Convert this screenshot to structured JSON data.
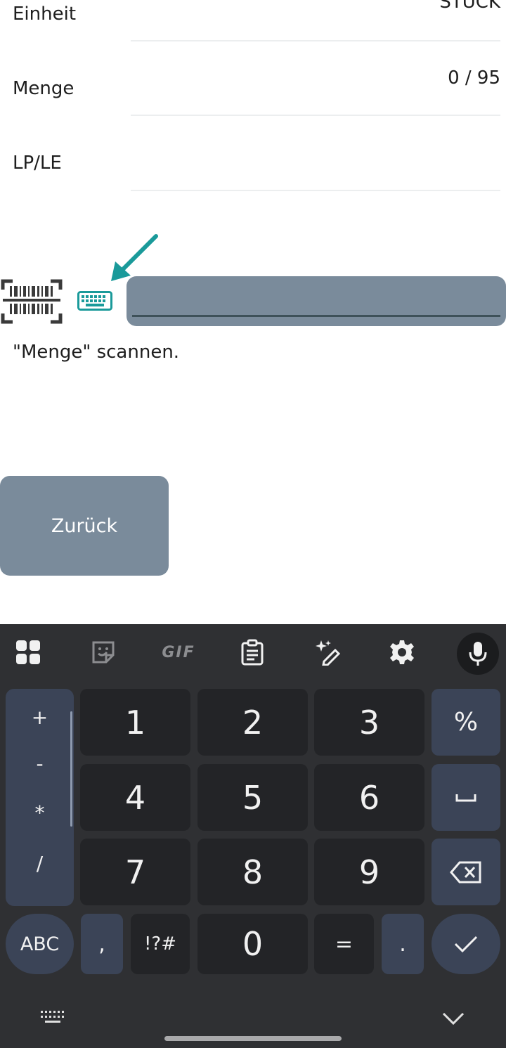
{
  "form": {
    "rows": [
      {
        "label": "Einheit",
        "value": "STÜCK"
      },
      {
        "label": "Menge",
        "value": "0 / 95"
      },
      {
        "label": "LP/LE",
        "value": ""
      }
    ]
  },
  "scan": {
    "input_value": "",
    "hint": "\"Menge\" scannen."
  },
  "buttons": {
    "back_label": "Zurück"
  },
  "colors": {
    "accent": "#7a8b9b",
    "annotation_arrow": "#1a9a9a",
    "keyboard_bg": "#2f3033"
  },
  "keyboard": {
    "toolbar_icons": [
      "apps-grid-icon",
      "sticker-icon",
      "gif-icon",
      "clipboard-icon",
      "magic-pen-icon",
      "settings-icon",
      "mic-icon"
    ],
    "toolbar_gif_label": "GIF",
    "symbols": [
      "+",
      "-",
      "*",
      "/"
    ],
    "digits": [
      "1",
      "2",
      "3",
      "4",
      "5",
      "6",
      "7",
      "8",
      "9",
      "0"
    ],
    "percent": "%",
    "comma": ",",
    "symbols_toggle": "!?#",
    "equals": "=",
    "period": ".",
    "abc": "ABC"
  }
}
